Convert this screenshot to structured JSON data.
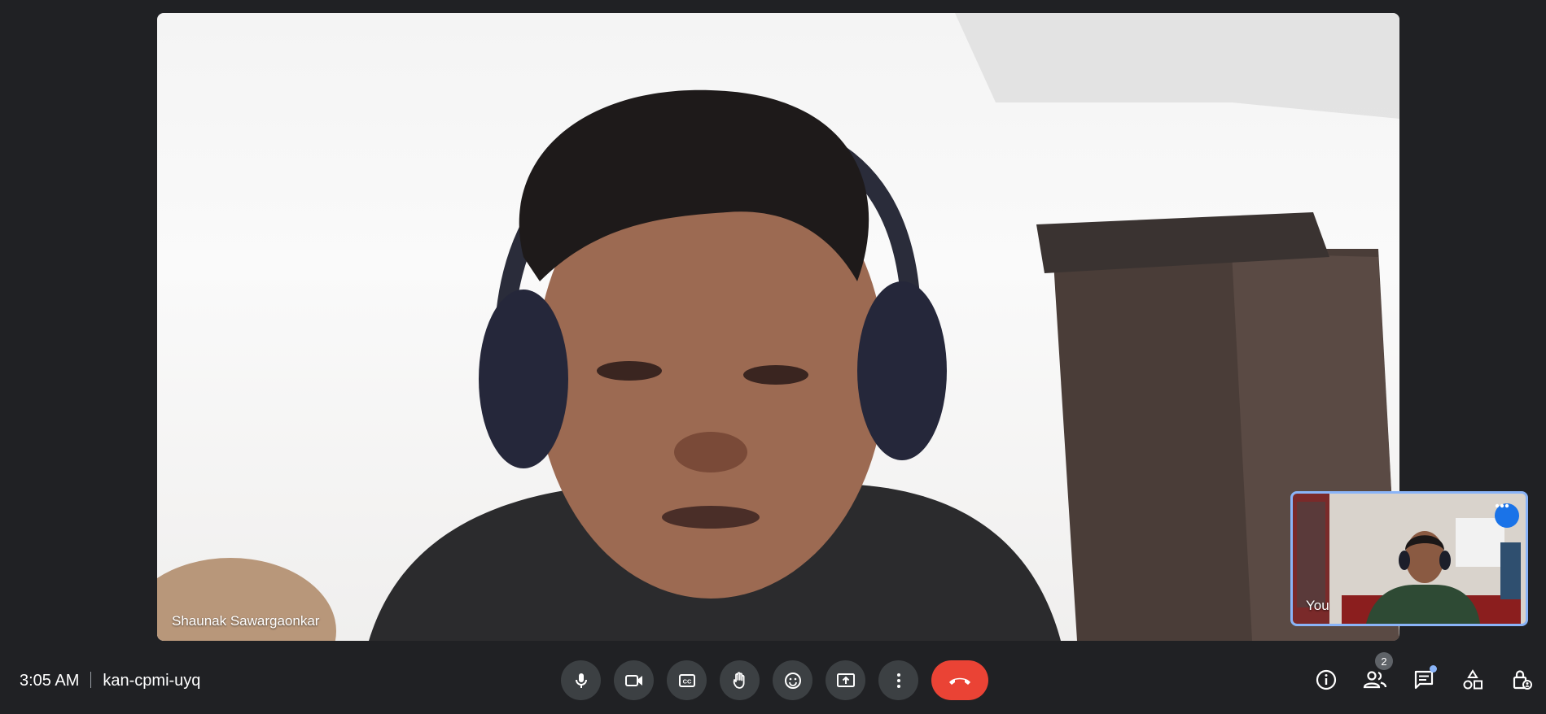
{
  "main_video": {
    "participant_name": "Shaunak Sawargaonkar"
  },
  "self_view": {
    "label": "You"
  },
  "meeting": {
    "time": "3:05 AM",
    "code": "kan-cpmi-uyq"
  },
  "controls": [
    {
      "icon": "mic-icon"
    },
    {
      "icon": "camera-icon"
    },
    {
      "icon": "captions-icon"
    },
    {
      "icon": "raise-hand-icon"
    },
    {
      "icon": "emoji-icon"
    },
    {
      "icon": "present-screen-icon"
    },
    {
      "icon": "more-options-icon"
    },
    {
      "icon": "end-call-icon",
      "color": "#ea4335"
    }
  ],
  "side_panel": {
    "people_count": "2"
  },
  "colors": {
    "background": "#202124",
    "accent": "#8ab4f8",
    "end_call": "#ea4335",
    "self_more": "#1a73e8"
  }
}
